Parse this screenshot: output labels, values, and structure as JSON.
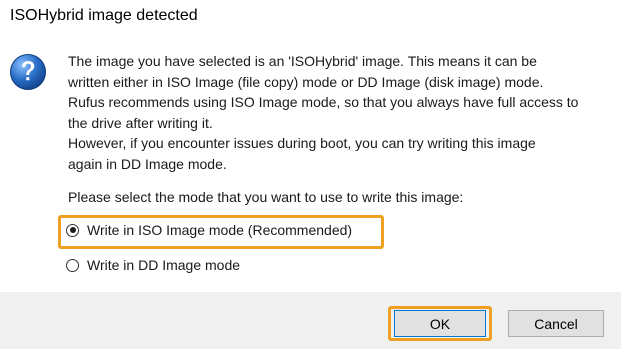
{
  "window": {
    "title": "ISOHybrid image detected"
  },
  "dialog": {
    "icon": "question-mark-icon",
    "message_lines": [
      "The image you have selected is an 'ISOHybrid' image. This means it can be",
      "written either in ISO Image (file copy) mode or DD Image (disk image) mode.",
      "Rufus recommends using ISO Image mode, so that you always have full access to",
      "the drive after writing it.",
      "However, if you encounter issues during boot, you can try writing this image",
      "again in DD Image mode."
    ],
    "prompt": "Please select the mode that you want to use to write this image:",
    "options": [
      {
        "label": "Write in ISO Image mode (Recommended)",
        "selected": true
      },
      {
        "label": "Write in DD Image mode",
        "selected": false
      }
    ]
  },
  "buttons": {
    "ok_label": "OK",
    "cancel_label": "Cancel"
  },
  "colors": {
    "highlight": "#f0a020",
    "footer_background": "#f0f0f0",
    "icon_blue": "#2b6fc8"
  }
}
